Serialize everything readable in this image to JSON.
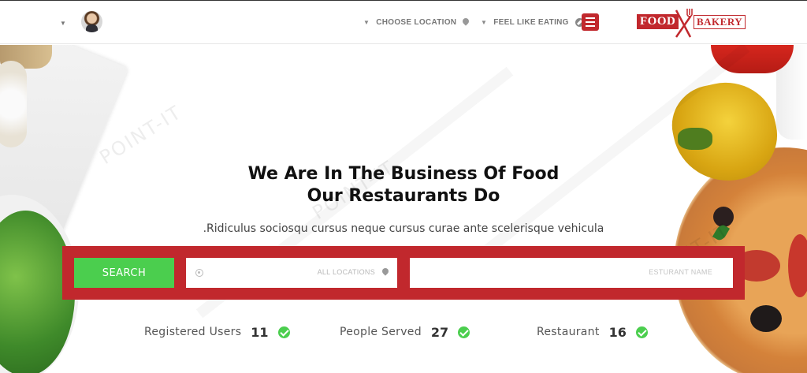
{
  "header": {
    "nav": {
      "choose_location": "CHOOSE LOCATION",
      "feel_like_eating": "FEEL LIKE EATING"
    },
    "logo": {
      "word_left": "FOOD",
      "word_right": "BAKERY"
    }
  },
  "hero": {
    "headline_line1": "We Are In The Business Of Food",
    "headline_line2": "Our Restaurants Do",
    "tagline": ".Ridiculus sociosqu cursus neque cursus curae ante scelerisque vehicula",
    "watermark": "POINT-IT"
  },
  "search": {
    "button_label": "SEARCH",
    "location_placeholder": "ALL LOCATIONS",
    "name_placeholder": "ESTURANT NAME"
  },
  "stats": [
    {
      "label": "Registered Users",
      "value": "11"
    },
    {
      "label": "People Served",
      "value": "27"
    },
    {
      "label": "Restaurant",
      "value": "16"
    }
  ],
  "colors": {
    "brand_red": "#c1282d",
    "search_green": "#4bce4e",
    "check_green": "#4bce4e"
  }
}
